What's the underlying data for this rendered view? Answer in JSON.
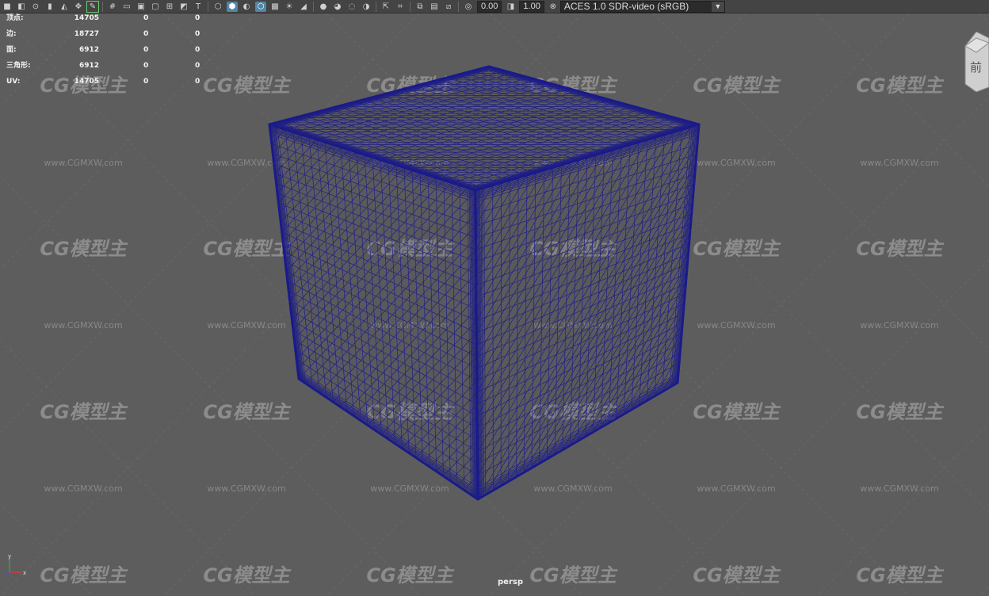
{
  "toolbar": {
    "exposure_value": "0.00",
    "gamma_value": "1.00",
    "color_space": "ACES 1.0 SDR-video (sRGB)",
    "icons": [
      "camera-icon",
      "camera-attr-icon",
      "bookmark-icon",
      "image-plane-icon",
      "grid-icon",
      "film-gate-icon",
      "resolution-gate-icon",
      "gate-mask-icon",
      "field-chart-icon",
      "safe-action-icon",
      "safe-title-icon",
      "wireframe-icon",
      "smooth-shade-icon",
      "wireframe-on-shaded-icon",
      "textured-icon",
      "lights-icon",
      "shadows-icon",
      "screen-space-ao-icon",
      "motion-blur-icon",
      "anti-alias-icon",
      "depth-of-field-icon",
      "isolate-icon",
      "xray-icon",
      "xray-joints-icon",
      "backface-icon",
      "exposure-icon",
      "gamma-icon",
      "color-management-icon"
    ]
  },
  "hud": {
    "rows": [
      {
        "label": "顶点:",
        "v1": "14705",
        "v2": "0",
        "v3": "0"
      },
      {
        "label": "边:",
        "v1": "18727",
        "v2": "0",
        "v3": "0"
      },
      {
        "label": "面:",
        "v1": "6912",
        "v2": "0",
        "v3": "0"
      },
      {
        "label": "三角形:",
        "v1": "6912",
        "v2": "0",
        "v3": "0"
      },
      {
        "label": "UV:",
        "v1": "14705",
        "v2": "0",
        "v3": "0"
      }
    ]
  },
  "viewport": {
    "camera": "persp",
    "viewcube_label": "前",
    "wire_color": "#1a1a8a",
    "background": "#5d5d5d"
  },
  "watermark": {
    "logo": "CG模型主",
    "url": "www.CGMXW.com"
  }
}
